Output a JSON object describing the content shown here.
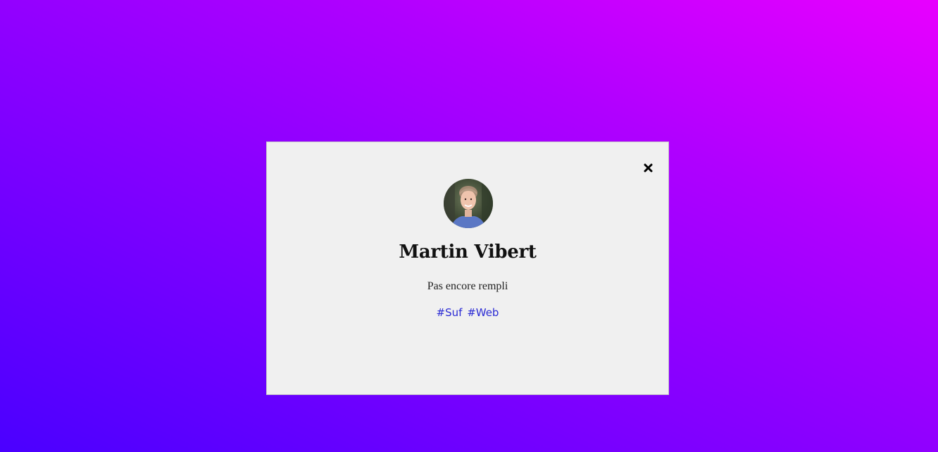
{
  "profile": {
    "name": "Martin Vibert",
    "description": "Pas encore rempli",
    "tags": [
      "#Suf",
      "#Web"
    ]
  },
  "icons": {
    "close": "close-icon",
    "avatar": "person-photo"
  },
  "colors": {
    "background_start": "#4a00ff",
    "background_end": "#e800ff",
    "modal_bg": "#f0f0f0",
    "tag_link": "#2b2bd4"
  }
}
